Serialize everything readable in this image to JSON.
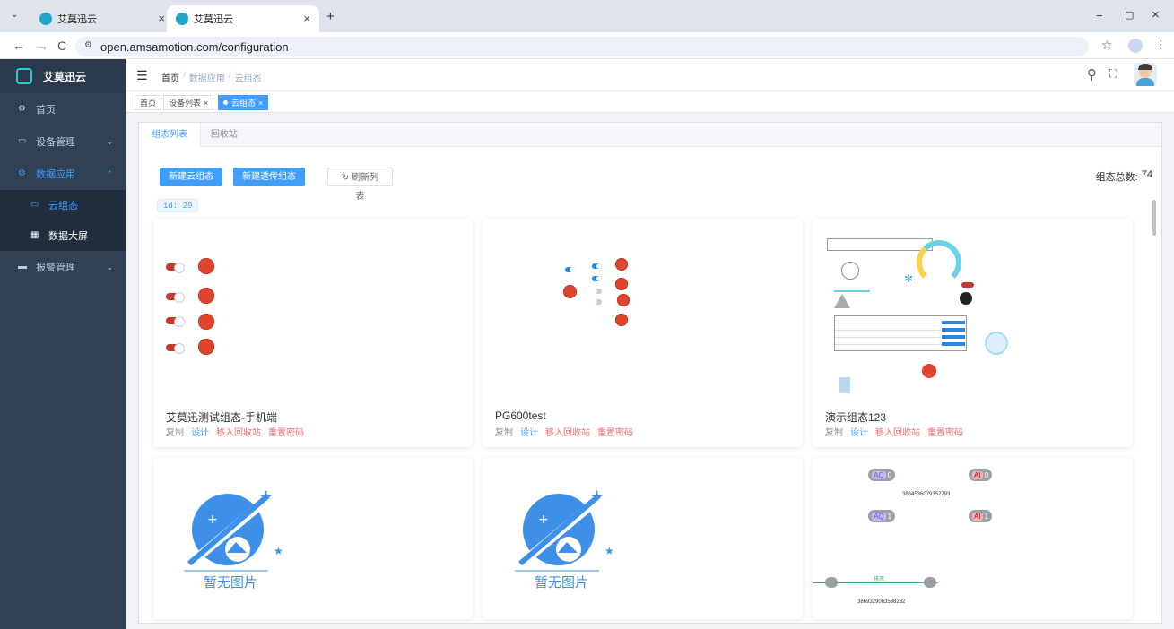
{
  "browser": {
    "tabs": [
      {
        "title": "艾莫迅云",
        "active": false
      },
      {
        "title": "艾莫迅云",
        "active": true
      }
    ],
    "new_tab": "+",
    "url": "open.amsamotion.com/configuration",
    "window_controls": {
      "minimize": "−",
      "restore": "▢",
      "close": "×"
    }
  },
  "sidebar": {
    "logo_text": "艾莫迅云",
    "items": [
      {
        "label": "首页",
        "icon": "dashboard-icon"
      },
      {
        "label": "设备管理",
        "icon": "monitor-icon",
        "has_children": true
      },
      {
        "label": "数据应用",
        "icon": "app-icon",
        "has_children": true,
        "expanded": true
      },
      {
        "label": "报警管理",
        "icon": "message-icon",
        "has_children": true
      }
    ],
    "sub_items": [
      {
        "label": "云组态",
        "active": true
      },
      {
        "label": "数据大屏",
        "active": false
      }
    ]
  },
  "header": {
    "breadcrumb": [
      "首页",
      "数据应用",
      "云组态"
    ],
    "separator": "/"
  },
  "tags": [
    {
      "label": "首页",
      "active": false,
      "closable": false
    },
    {
      "label": "设备列表",
      "active": false,
      "closable": true
    },
    {
      "label": "云组态",
      "active": true,
      "closable": true
    }
  ],
  "panel": {
    "tabs": [
      {
        "label": "组态列表",
        "active": true
      },
      {
        "label": "回收站",
        "active": false
      }
    ],
    "buttons": {
      "new_cloud": "新建云组态",
      "new_passthrough": "新建透传组态",
      "refresh": "刷新列表"
    },
    "total_label": "组态总数:",
    "total_count": "74",
    "id_badge": "id: 29",
    "cards": [
      {
        "title": "艾莫迅测试组态-手机端"
      },
      {
        "title": "PG600test"
      },
      {
        "title": "演示组态123"
      },
      {
        "no_image": "暂无图片"
      },
      {
        "no_image": "暂无图片"
      },
      {
        "id_top": "3864536079352793",
        "id_bottom": "3869329063536232",
        "line_label": "排风",
        "pills": [
          "AQ",
          "0",
          "AI",
          "0",
          "AQ",
          "1",
          "AI",
          "1"
        ]
      }
    ],
    "actions": {
      "copy": "复制",
      "design": "设计",
      "recycle": "移入回收站",
      "reset": "重置密码"
    }
  }
}
